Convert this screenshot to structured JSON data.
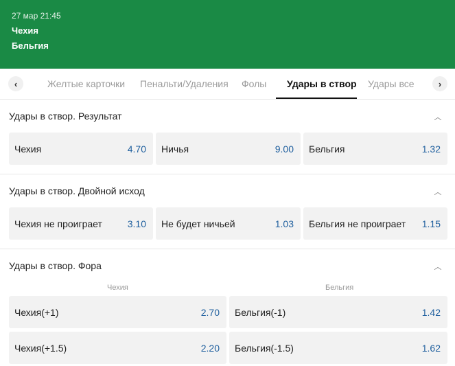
{
  "header": {
    "datetime": "27 мар 21:45",
    "team1": "Чехия",
    "team2": "Бельгия"
  },
  "tabs": [
    {
      "label": "Желтые карточки"
    },
    {
      "label": "Пенальти/Удаления"
    },
    {
      "label": "Фолы"
    },
    {
      "label": "Удары в створ"
    },
    {
      "label": "Удары все"
    }
  ],
  "active_tab": "Удары в створ",
  "sections": [
    {
      "title": "Удары в створ. Результат",
      "options": [
        {
          "label": "Чехия",
          "odd": "4.70"
        },
        {
          "label": "Ничья",
          "odd": "9.00"
        },
        {
          "label": "Бельгия",
          "odd": "1.32"
        }
      ]
    },
    {
      "title": "Удары в створ. Двойной исход",
      "options": [
        {
          "label": "Чехия не проиграет",
          "odd": "3.10"
        },
        {
          "label": "Не будет ничьей",
          "odd": "1.03"
        },
        {
          "label": "Бельгия не проиграет",
          "odd": "1.15"
        }
      ]
    },
    {
      "title": "Удары в створ. Фора",
      "columns": [
        "Чехия",
        "Бельгия"
      ],
      "rows": [
        [
          {
            "label": "Чехия(+1)",
            "odd": "2.70"
          },
          {
            "label": "Бельгия(-1)",
            "odd": "1.42"
          }
        ],
        [
          {
            "label": "Чехия(+1.5)",
            "odd": "2.20"
          },
          {
            "label": "Бельгия(-1.5)",
            "odd": "1.62"
          }
        ]
      ]
    }
  ],
  "colors": {
    "header_bg": "#1a8a45",
    "odd_text": "#1f5f9e",
    "cell_bg": "#f2f2f2"
  },
  "icons": {
    "prev": "chevron-left-icon",
    "next": "chevron-right-icon",
    "collapse": "chevron-up-icon"
  }
}
